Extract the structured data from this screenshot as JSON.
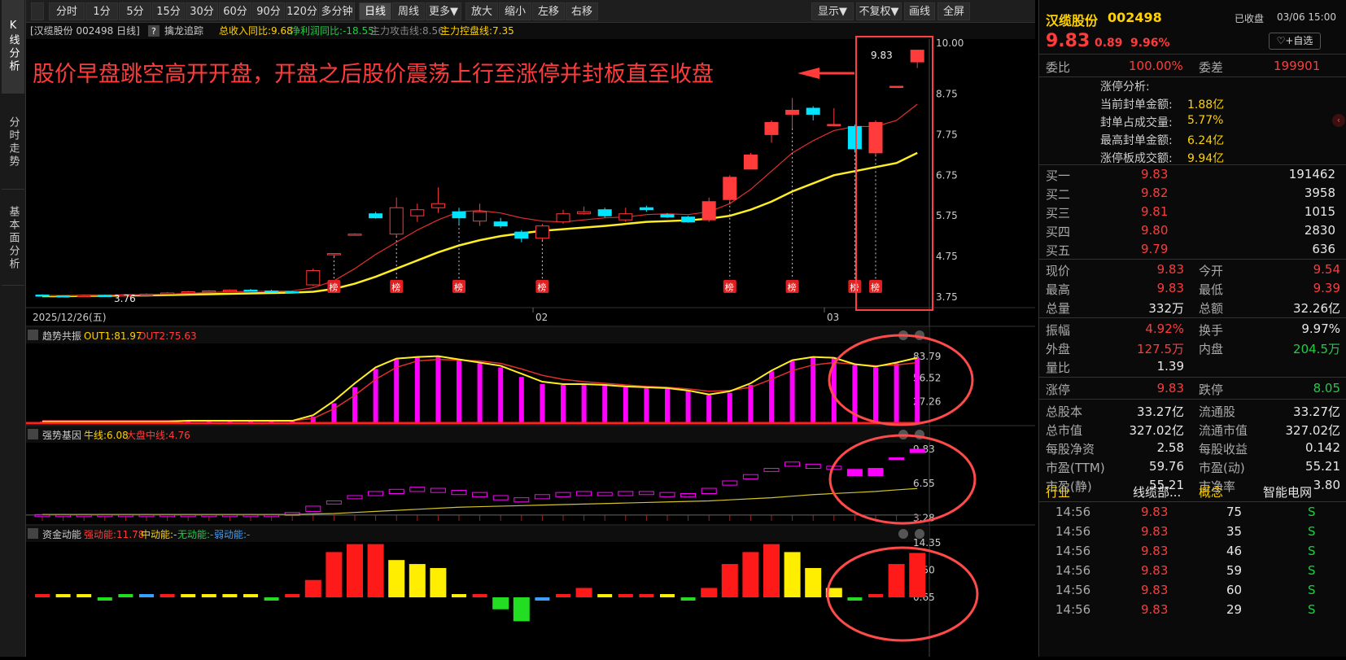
{
  "toolbar": {
    "buttons": [
      "分时",
      "1分",
      "5分",
      "15分",
      "30分",
      "60分",
      "90分",
      "120分",
      "多分钟",
      "日线",
      "周线",
      "更多▼",
      "放大",
      "缩小",
      "左移",
      "右移"
    ],
    "active": "日线",
    "right_buttons": [
      "显示▼",
      "不复权▼",
      "画线",
      "全屏"
    ]
  },
  "left_nav": [
    "K线分析",
    "分时走势",
    "基本面分析"
  ],
  "main_header": {
    "title": "[汉缆股份 002498 日线]",
    "q": "?",
    "indicator": "擒龙追踪",
    "item1": "总收入同比:9.68",
    "item2": "净利润同比:-18.55",
    "item3": "主力攻击线:8.56",
    "item4": "主力控盘线:7.35"
  },
  "annotation": "股价早盘跳空高开开盘，开盘之后股价震荡上行至涨停并封板直至收盘",
  "price_axis": [
    "10.00",
    "8.75",
    "7.75",
    "6.75",
    "5.75",
    "4.75",
    "3.75"
  ],
  "date_axis": [
    "2025/12/26(五)",
    "02",
    "03"
  ],
  "marks": {
    "low_label": "3.76",
    "high_label": "9.83",
    "bang": "榜"
  },
  "panel2": {
    "title": "趋势共振",
    "out1": "OUT1:81.97",
    "out2": "OUT2:75.63",
    "axis": [
      "83.79",
      "56.52",
      "27.26"
    ]
  },
  "panel3": {
    "title": "强势基因",
    "line1": "牛线:6.08",
    "line2": "大盘中线:4.76",
    "axis": [
      "9.83",
      "6.55",
      "3.28"
    ]
  },
  "panel4": {
    "title": "资金动能",
    "s": "强动能:11.78",
    "m": "中动能:-",
    "n": "无动能:-",
    "w": "弱动能:-",
    "axis": [
      "14.35",
      "7.50",
      "0.65"
    ]
  },
  "colors": {
    "up": "#ff3b3b",
    "down": "#00e5ff",
    "ma5": "#e03030",
    "ma10": "#ffee22",
    "magenta": "#ff00ff",
    "annot": "#ff3b3b"
  },
  "chart_data": {
    "type": "candlestick",
    "candles": [
      [
        3.8,
        3.78,
        3.82,
        3.76
      ],
      [
        3.78,
        3.77,
        3.8,
        3.75
      ],
      [
        3.77,
        3.79,
        3.81,
        3.76
      ],
      [
        3.79,
        3.78,
        3.81,
        3.76
      ],
      [
        3.78,
        3.8,
        3.82,
        3.77
      ],
      [
        3.8,
        3.82,
        3.84,
        3.79
      ],
      [
        3.82,
        3.85,
        3.87,
        3.81
      ],
      [
        3.85,
        3.88,
        3.9,
        3.84
      ],
      [
        3.88,
        3.9,
        3.92,
        3.87
      ],
      [
        3.9,
        3.92,
        3.94,
        3.89
      ],
      [
        3.92,
        3.9,
        3.95,
        3.88
      ],
      [
        3.9,
        3.88,
        3.93,
        3.86
      ],
      [
        3.88,
        3.87,
        3.9,
        3.85
      ],
      [
        4.05,
        4.4,
        4.45,
        4.02
      ],
      [
        4.8,
        4.82,
        4.83,
        4.75
      ],
      [
        5.28,
        5.3,
        5.32,
        5.26
      ],
      [
        5.8,
        5.7,
        5.85,
        5.68
      ],
      [
        5.3,
        5.95,
        6.2,
        5.25
      ],
      [
        5.75,
        5.9,
        6.05,
        5.6
      ],
      [
        5.95,
        6.05,
        6.45,
        5.82
      ],
      [
        5.85,
        5.7,
        5.95,
        5.55
      ],
      [
        5.62,
        5.85,
        6.05,
        5.5
      ],
      [
        5.6,
        5.5,
        5.7,
        5.45
      ],
      [
        5.35,
        5.2,
        5.4,
        5.1
      ],
      [
        5.2,
        5.5,
        5.55,
        5.15
      ],
      [
        5.6,
        5.8,
        5.9,
        5.55
      ],
      [
        5.8,
        5.85,
        5.98,
        5.78
      ],
      [
        5.9,
        5.75,
        5.95,
        5.7
      ],
      [
        5.65,
        5.8,
        5.95,
        5.6
      ],
      [
        5.95,
        5.9,
        6.0,
        5.85
      ],
      [
        5.78,
        5.72,
        5.82,
        5.7
      ],
      [
        5.72,
        5.6,
        5.75,
        5.58
      ],
      [
        5.65,
        6.1,
        6.2,
        5.6
      ],
      [
        6.15,
        6.7,
        6.75,
        6.1
      ],
      [
        6.9,
        7.25,
        7.3,
        6.9
      ],
      [
        7.75,
        8.05,
        8.1,
        7.55
      ],
      [
        8.25,
        8.35,
        8.65,
        7.9
      ],
      [
        8.4,
        8.25,
        8.45,
        8.1
      ],
      [
        8.0,
        8.0,
        8.4,
        7.95
      ],
      [
        7.95,
        7.4,
        8.0,
        7.35
      ],
      [
        7.3,
        8.05,
        8.1,
        7.25
      ],
      [
        8.92,
        8.94,
        8.95,
        8.9
      ],
      [
        9.54,
        9.83,
        9.83,
        9.39
      ]
    ],
    "ma5": [
      3.78,
      3.78,
      3.79,
      3.79,
      3.8,
      3.81,
      3.82,
      3.84,
      3.86,
      3.88,
      3.89,
      3.89,
      3.9,
      3.98,
      4.15,
      4.45,
      4.8,
      5.1,
      5.4,
      5.65,
      5.85,
      5.88,
      5.82,
      5.7,
      5.62,
      5.6,
      5.65,
      5.7,
      5.72,
      5.78,
      5.8,
      5.78,
      5.85,
      6.05,
      6.4,
      6.85,
      7.3,
      7.6,
      7.85,
      7.95,
      7.95,
      8.1,
      8.5
    ],
    "ma10": [
      3.77,
      3.77,
      3.78,
      3.78,
      3.79,
      3.79,
      3.8,
      3.81,
      3.82,
      3.83,
      3.84,
      3.85,
      3.86,
      3.88,
      3.95,
      4.08,
      4.25,
      4.45,
      4.65,
      4.85,
      5.02,
      5.15,
      5.25,
      5.32,
      5.38,
      5.42,
      5.46,
      5.5,
      5.55,
      5.6,
      5.62,
      5.64,
      5.68,
      5.75,
      5.9,
      6.1,
      6.35,
      6.55,
      6.75,
      6.85,
      6.95,
      7.05,
      7.3
    ],
    "bang_at": [
      14,
      17,
      20,
      24,
      33,
      36,
      39,
      40
    ],
    "osc_bars": [
      2,
      2,
      2,
      2,
      2,
      2,
      2,
      3,
      3,
      3,
      3,
      3,
      3,
      8,
      25,
      45,
      68,
      80,
      83,
      84,
      80,
      75,
      70,
      58,
      49,
      48,
      48,
      47,
      45,
      44,
      43,
      40,
      35,
      38,
      48,
      65,
      78,
      82,
      81,
      73,
      70,
      75,
      82
    ],
    "osc_line1": [
      2,
      2,
      2,
      2,
      2,
      2,
      2,
      3,
      3,
      3,
      3,
      3,
      3,
      10,
      28,
      50,
      70,
      81,
      83,
      84,
      80,
      76,
      72,
      62,
      52,
      49,
      49,
      48,
      46,
      45,
      44,
      41,
      36,
      40,
      50,
      66,
      79,
      83,
      82,
      74,
      71,
      76,
      82
    ],
    "osc_line2": [
      3,
      3,
      3,
      3,
      3,
      3,
      3,
      3,
      3,
      3,
      3,
      3,
      3,
      6,
      18,
      35,
      55,
      70,
      78,
      80,
      79,
      78,
      75,
      68,
      60,
      55,
      52,
      50,
      48,
      46,
      45,
      43,
      40,
      41,
      45,
      55,
      66,
      73,
      76,
      74,
      72,
      73,
      76
    ],
    "gene_box": [
      [
        3.4,
        3.6
      ],
      [
        3.4,
        3.6
      ],
      [
        3.4,
        3.6
      ],
      [
        3.4,
        3.6
      ],
      [
        3.4,
        3.6
      ],
      [
        3.4,
        3.6
      ],
      [
        3.4,
        3.6
      ],
      [
        3.4,
        3.6
      ],
      [
        3.4,
        3.6
      ],
      [
        3.4,
        3.6
      ],
      [
        3.4,
        3.6
      ],
      [
        3.4,
        3.6
      ],
      [
        3.5,
        3.8
      ],
      [
        3.9,
        4.4
      ],
      [
        4.6,
        4.9
      ],
      [
        5.1,
        5.4
      ],
      [
        5.4,
        5.8
      ],
      [
        5.6,
        6.0
      ],
      [
        5.8,
        6.2
      ],
      [
        5.7,
        6.1
      ],
      [
        5.5,
        5.9
      ],
      [
        5.3,
        5.7
      ],
      [
        5.0,
        5.4
      ],
      [
        4.8,
        5.2
      ],
      [
        5.1,
        5.5
      ],
      [
        5.3,
        5.7
      ],
      [
        5.4,
        5.8
      ],
      [
        5.4,
        5.7
      ],
      [
        5.4,
        5.8
      ],
      [
        5.5,
        5.8
      ],
      [
        5.3,
        5.7
      ],
      [
        5.3,
        5.6
      ],
      [
        5.6,
        6.1
      ],
      [
        6.4,
        6.8
      ],
      [
        7.0,
        7.4
      ],
      [
        7.7,
        8.0
      ],
      [
        8.2,
        8.6
      ],
      [
        8.0,
        8.4
      ],
      [
        7.9,
        8.2
      ],
      [
        7.3,
        7.9
      ],
      [
        7.3,
        8.0
      ],
      [
        8.9,
        9.0
      ],
      [
        9.5,
        9.83
      ]
    ],
    "gene_line": [
      3.6,
      3.6,
      3.6,
      3.6,
      3.6,
      3.6,
      3.6,
      3.6,
      3.6,
      3.6,
      3.6,
      3.6,
      3.6,
      3.65,
      3.7,
      3.8,
      3.9,
      4.0,
      4.1,
      4.2,
      4.3,
      4.35,
      4.4,
      4.45,
      4.5,
      4.55,
      4.6,
      4.65,
      4.7,
      4.75,
      4.8,
      4.85,
      4.9,
      5.0,
      5.1,
      5.2,
      5.35,
      5.5,
      5.6,
      5.7,
      5.8,
      5.95,
      6.08
    ],
    "fund_bars": [
      1,
      1,
      1,
      -1,
      1,
      2,
      2,
      2,
      2,
      1,
      1,
      -1,
      1,
      5,
      12,
      14,
      14,
      10,
      9,
      8,
      1,
      2,
      -3,
      -6,
      -1,
      2,
      3,
      1,
      2,
      2,
      1,
      -1,
      3,
      9,
      12,
      14,
      12,
      8,
      3,
      -1,
      1,
      9,
      11.78
    ],
    "fund_colors": [
      "r",
      "y",
      "y",
      "g",
      "g",
      "b",
      "r",
      "y",
      "y",
      "y",
      "y",
      "g",
      "r",
      "r",
      "r",
      "r",
      "r",
      "y",
      "y",
      "y",
      "y",
      "r",
      "g",
      "g",
      "b",
      "r",
      "r",
      "y",
      "r",
      "r",
      "y",
      "g",
      "r",
      "r",
      "r",
      "r",
      "y",
      "y",
      "y",
      "g",
      "r",
      "r",
      "r"
    ]
  },
  "right": {
    "name": "汉缆股份",
    "code": "002498",
    "status": "已收盘",
    "time": "03/06 15:00",
    "price": "9.83",
    "change": "0.89",
    "pct": "9.96%",
    "fav": "+自选",
    "weibi_l": "委比",
    "weibi_v": "100.00%",
    "weicha_l": "委差",
    "weicha_v": "199901",
    "zt_title": "涨停分析:",
    "zt": [
      {
        "l": "当前封单金额:",
        "v": "1.88亿"
      },
      {
        "l": "封单占成交量:",
        "v": "5.77%"
      },
      {
        "l": "最高封单金额:",
        "v": "6.24亿"
      },
      {
        "l": "涨停板成交额:",
        "v": "9.94亿"
      }
    ],
    "book": [
      {
        "l": "买一",
        "p": "9.83",
        "v": "191462"
      },
      {
        "l": "买二",
        "p": "9.82",
        "v": "3958"
      },
      {
        "l": "买三",
        "p": "9.81",
        "v": "1015"
      },
      {
        "l": "买四",
        "p": "9.80",
        "v": "2830"
      },
      {
        "l": "买五",
        "p": "9.79",
        "v": "636"
      }
    ],
    "stats": [
      {
        "l1": "现价",
        "v1": "9.83",
        "c1": "red",
        "l2": "今开",
        "v2": "9.54",
        "c2": "red"
      },
      {
        "l1": "最高",
        "v1": "9.83",
        "c1": "red",
        "l2": "最低",
        "v2": "9.39",
        "c2": "red"
      },
      {
        "l1": "总量",
        "v1": "332万",
        "c1": "white",
        "l2": "总额",
        "v2": "32.26亿",
        "c2": "white"
      },
      {
        "l1": "振幅",
        "v1": "4.92%",
        "c1": "red",
        "l2": "换手",
        "v2": "9.97%",
        "c2": "white"
      },
      {
        "l1": "外盘",
        "v1": "127.5万",
        "c1": "red",
        "l2": "内盘",
        "v2": "204.5万",
        "c2": "green"
      },
      {
        "l1": "量比",
        "v1": "1.39",
        "c1": "white",
        "l2": "",
        "v2": "",
        "c2": "white"
      },
      {
        "l1": "涨停",
        "v1": "9.83",
        "c1": "red",
        "l2": "跌停",
        "v2": "8.05",
        "c2": "green"
      },
      {
        "l1": "总股本",
        "v1": "33.27亿",
        "c1": "white",
        "l2": "流通股",
        "v2": "33.27亿",
        "c2": "white"
      },
      {
        "l1": "总市值",
        "v1": "327.02亿",
        "c1": "white",
        "l2": "流通市值",
        "v2": "327.02亿",
        "c2": "white"
      },
      {
        "l1": "每股净资",
        "v1": "2.58",
        "c1": "white",
        "l2": "每股收益",
        "v2": "0.142",
        "c2": "white"
      },
      {
        "l1": "市盈(TTM)",
        "v1": "59.76",
        "c1": "white",
        "l2": "市盈(动)",
        "v2": "55.21",
        "c2": "white"
      },
      {
        "l1": "市盈(静)",
        "v1": "55.21",
        "c1": "white",
        "l2": "市净率",
        "v2": "3.80",
        "c2": "white"
      }
    ],
    "industry_l": "行业",
    "industry_v": "线缆部...",
    "concept_l": "概念",
    "concept_v": "智能电网",
    "ticks": [
      {
        "t": "14:56",
        "p": "9.83",
        "v": "75",
        "s": "S"
      },
      {
        "t": "14:56",
        "p": "9.83",
        "v": "35",
        "s": "S"
      },
      {
        "t": "14:56",
        "p": "9.83",
        "v": "46",
        "s": "S"
      },
      {
        "t": "14:56",
        "p": "9.83",
        "v": "59",
        "s": "S"
      },
      {
        "t": "14:56",
        "p": "9.83",
        "v": "60",
        "s": "S"
      },
      {
        "t": "14:56",
        "p": "9.83",
        "v": "29",
        "s": "S"
      }
    ]
  }
}
